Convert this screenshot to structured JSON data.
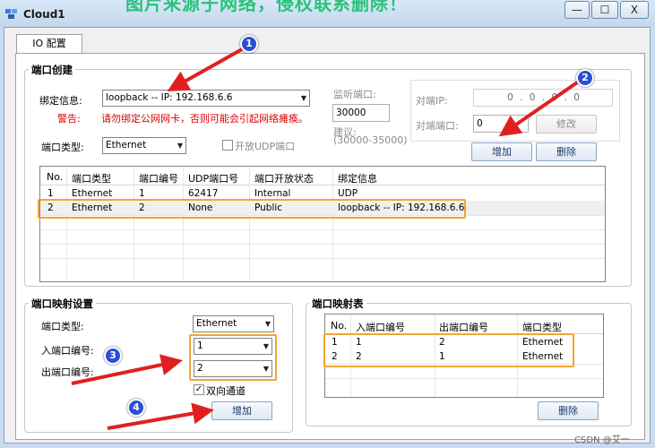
{
  "window": {
    "title": "Cloud1",
    "banner_text": "图片来源于网络，侵权联系删除！",
    "minimize": "—",
    "maximize": "☐",
    "close": "X"
  },
  "tabs": [
    {
      "label": "IO 配置"
    }
  ],
  "port_create": {
    "title": "端口创建",
    "bind_label": "绑定信息:",
    "bind_value": "loopback -- IP: 192.168.6.6",
    "warning_label": "警告:",
    "warning_text": "请勿绑定公网网卡，否则可能会引起网络瘫痪。",
    "port_type_label": "端口类型:",
    "port_type_value": "Ethernet",
    "open_udp_label": "开放UDP端口",
    "listen_port_label": "监听端口:",
    "listen_port_value": "30000",
    "suggest_label": "建议:",
    "suggest_range": "(30000-35000)",
    "remote_ip_label": "对端IP:",
    "remote_ip_value": "0 . 0 . 0 . 0",
    "remote_port_label": "对端端口:",
    "remote_port_value": "0",
    "modify_button": "修改",
    "add_button": "增加",
    "delete_button": "删除",
    "table": {
      "headers": [
        "No.",
        "端口类型",
        "端口编号",
        "UDP端口号",
        "端口开放状态",
        "绑定信息"
      ],
      "rows": [
        [
          "1",
          "Ethernet",
          "1",
          "62417",
          "Internal",
          "UDP"
        ],
        [
          "2",
          "Ethernet",
          "2",
          "None",
          "Public",
          "loopback -- IP: 192.168.6.6"
        ]
      ]
    }
  },
  "port_map_settings": {
    "title": "端口映射设置",
    "port_type_label": "端口类型:",
    "port_type_value": "Ethernet",
    "in_port_label": "入端口编号:",
    "in_port_value": "1",
    "out_port_label": "出端口编号:",
    "out_port_value": "2",
    "bidirectional_label": "双向通道",
    "bidirectional_checked": true,
    "add_button": "增加"
  },
  "port_map_table": {
    "title": "端口映射表",
    "headers": [
      "No.",
      "入端口编号",
      "出端口编号",
      "端口类型"
    ],
    "rows": [
      [
        "1",
        "1",
        "2",
        "Ethernet"
      ],
      [
        "2",
        "2",
        "1",
        "Ethernet"
      ]
    ],
    "delete_button": "删除"
  },
  "annotations": {
    "markers": [
      "1",
      "2",
      "3",
      "4"
    ],
    "highlight_color": "#f2a531",
    "arrow_color": "#e02020",
    "marker_color": "#2a4fd6"
  },
  "watermark": "CSDN @艾一"
}
